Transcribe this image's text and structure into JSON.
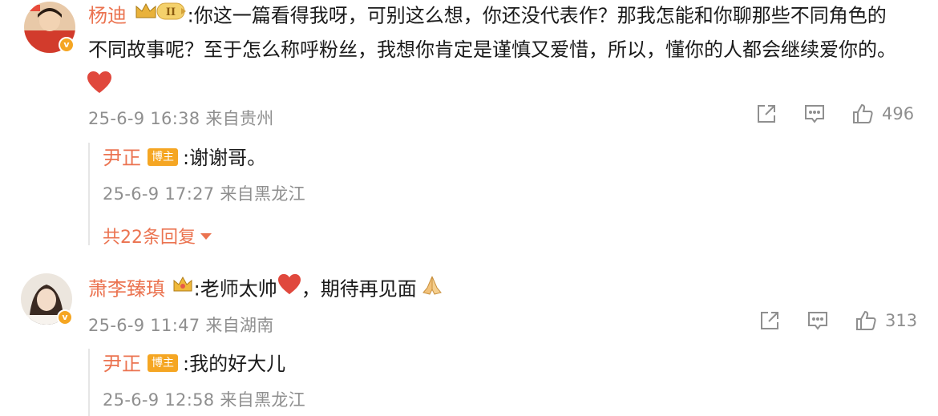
{
  "comments": [
    {
      "user": "杨迪",
      "text_line1": ":你这一篇看得我呀，可别这么想，你还没代表作？那我怎能和你聊那些不同角色的",
      "text_line2": "不同故事呢？至于怎么称呼粉丝，我想你肯定是谨慎又爱惜，所以，懂你的人都会继续爱你的。",
      "emoji": "heart",
      "meta": "25-6-9 16:38 来自贵州",
      "likes": "496",
      "reply": {
        "user": "尹正",
        "badge": "博主",
        "text": ":谢谢哥。",
        "meta": "25-6-9 17:27 来自黑龙江"
      },
      "more_replies": "共22条回复"
    },
    {
      "user": "萧李臻瑱",
      "text_a": ":老师太帅",
      "text_b": "，期待再见面",
      "meta": "25-6-9 11:47 来自湖南",
      "likes": "313",
      "reply": {
        "user": "尹正",
        "badge": "博主",
        "text": ":我的好大儿",
        "meta": "25-6-9 12:58 来自黑龙江"
      }
    }
  ],
  "icons": {
    "share": "share-icon",
    "comment": "comment-icon",
    "like": "thumbs-up-icon",
    "vip": "crown-vip-icon",
    "verified": "verified-v-icon"
  },
  "colors": {
    "username": "#eb7350",
    "meta": "#8f8f8f",
    "badge": "#f5a623",
    "heart": "#e0483d"
  }
}
